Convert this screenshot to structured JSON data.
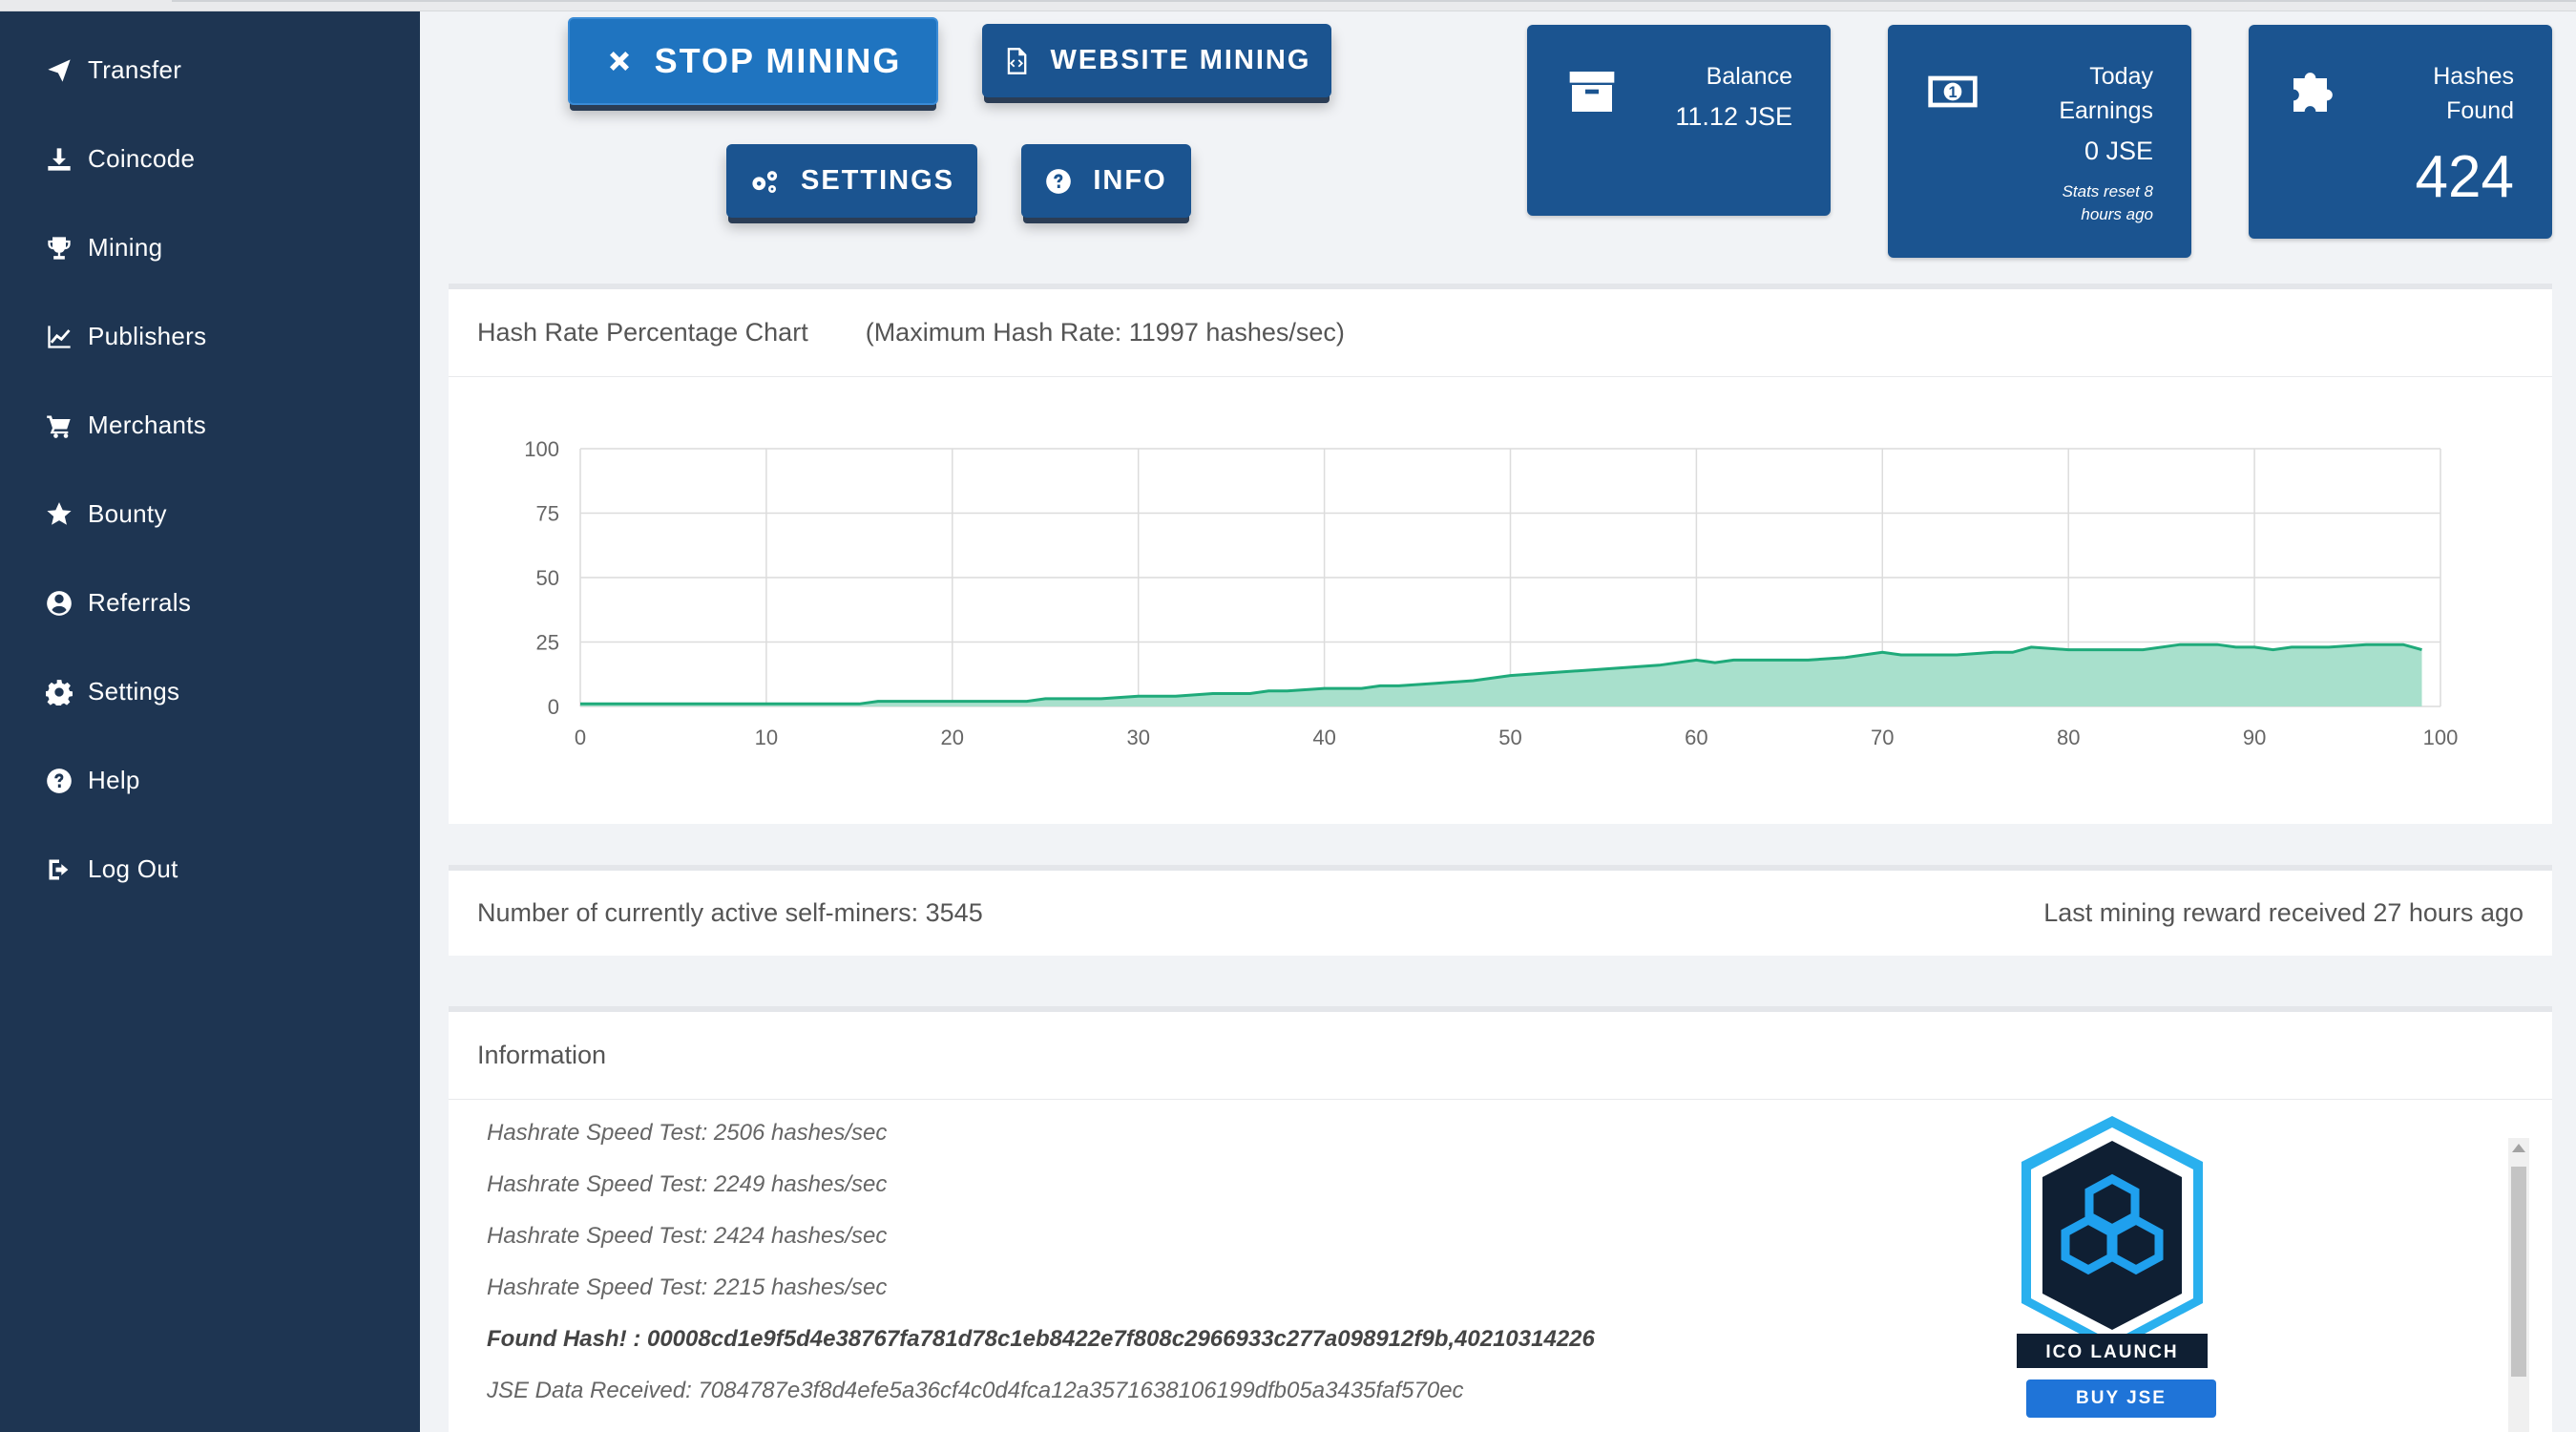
{
  "sidebar": {
    "items": [
      {
        "label": "Transfer",
        "icon": "send-icon"
      },
      {
        "label": "Coincode",
        "icon": "download-icon"
      },
      {
        "label": "Mining",
        "icon": "trophy-icon"
      },
      {
        "label": "Publishers",
        "icon": "line-chart-icon"
      },
      {
        "label": "Merchants",
        "icon": "cart-icon"
      },
      {
        "label": "Bounty",
        "icon": "star-icon"
      },
      {
        "label": "Referrals",
        "icon": "user-circle-icon"
      },
      {
        "label": "Settings",
        "icon": "gear-icon"
      },
      {
        "label": "Help",
        "icon": "question-circle-icon"
      },
      {
        "label": "Log Out",
        "icon": "sign-out-icon"
      }
    ]
  },
  "actions": {
    "stop_mining": "STOP MINING",
    "website_mining": "WEBSITE MINING",
    "settings": "SETTINGS",
    "info": "INFO"
  },
  "stats": {
    "balance_label": "Balance",
    "balance_value": "11.12 JSE",
    "today_label_1": "Today",
    "today_label_2": "Earnings",
    "today_value": "0 JSE",
    "today_note_1": "Stats reset 8",
    "today_note_2": "hours ago",
    "hashes_label_1": "Hashes",
    "hashes_label_2": "Found",
    "hashes_value": "424"
  },
  "chart_card": {
    "title": "Hash Rate Percentage Chart",
    "subtitle": "(Maximum Hash Rate: 11997 hashes/sec)"
  },
  "chart_data": {
    "type": "area",
    "title": "",
    "xlabel": "",
    "ylabel": "",
    "xlim": [
      0,
      100
    ],
    "ylim": [
      0,
      100
    ],
    "x_ticks": [
      0,
      10,
      20,
      30,
      40,
      50,
      60,
      70,
      80,
      90,
      100
    ],
    "y_ticks": [
      0,
      25,
      50,
      75,
      100
    ],
    "grid": true,
    "color": "#1faa7a",
    "fill": "#a8e0cc",
    "series": [
      {
        "x": [
          0,
          2,
          4,
          6,
          8,
          10,
          12,
          14,
          15,
          16,
          18,
          20,
          22,
          24,
          25,
          26,
          28,
          30,
          31,
          32,
          34,
          36,
          37,
          38,
          40,
          42,
          43,
          44,
          46,
          48,
          50,
          52,
          54,
          56,
          58,
          60,
          61,
          62,
          64,
          66,
          68,
          70,
          71,
          72,
          74,
          76,
          77,
          78,
          80,
          82,
          84,
          86,
          88,
          89,
          90,
          91,
          92,
          94,
          96,
          98,
          99
        ],
        "y": [
          1,
          1,
          1,
          1,
          1,
          1,
          1,
          1,
          1,
          2,
          2,
          2,
          2,
          2,
          3,
          3,
          3,
          4,
          4,
          4,
          5,
          5,
          6,
          6,
          7,
          7,
          8,
          8,
          9,
          10,
          12,
          13,
          14,
          15,
          16,
          18,
          17,
          18,
          18,
          18,
          19,
          21,
          20,
          20,
          20,
          21,
          21,
          23,
          22,
          22,
          22,
          24,
          24,
          23,
          23,
          22,
          23,
          23,
          24,
          24,
          22
        ]
      }
    ]
  },
  "miners": {
    "active": "Number of currently active self-miners: 3545",
    "last_reward": "Last mining reward received 27 hours ago"
  },
  "info_card": {
    "title": "Information",
    "log": [
      {
        "text": "Hashrate Speed Test: 2506 hashes/sec",
        "bold": false
      },
      {
        "text": "Hashrate Speed Test: 2249 hashes/sec",
        "bold": false
      },
      {
        "text": "Hashrate Speed Test: 2424 hashes/sec",
        "bold": false
      },
      {
        "text": "Hashrate Speed Test: 2215 hashes/sec",
        "bold": false
      },
      {
        "text": "Found Hash! : 00008cd1e9f5d4e38767fa781d78c1eb8422e7f808c2966933c277a098912f9b,40210314226",
        "bold": true
      },
      {
        "text": "JSE Data Received: 7084787e3f8d4efe5a36cf4c0d4fca12a3571638106199dfb05a3435faf570ec",
        "bold": false
      }
    ]
  },
  "promo": {
    "badge_text": "ICO LAUNCH",
    "buy_label": "BUY JSE"
  }
}
